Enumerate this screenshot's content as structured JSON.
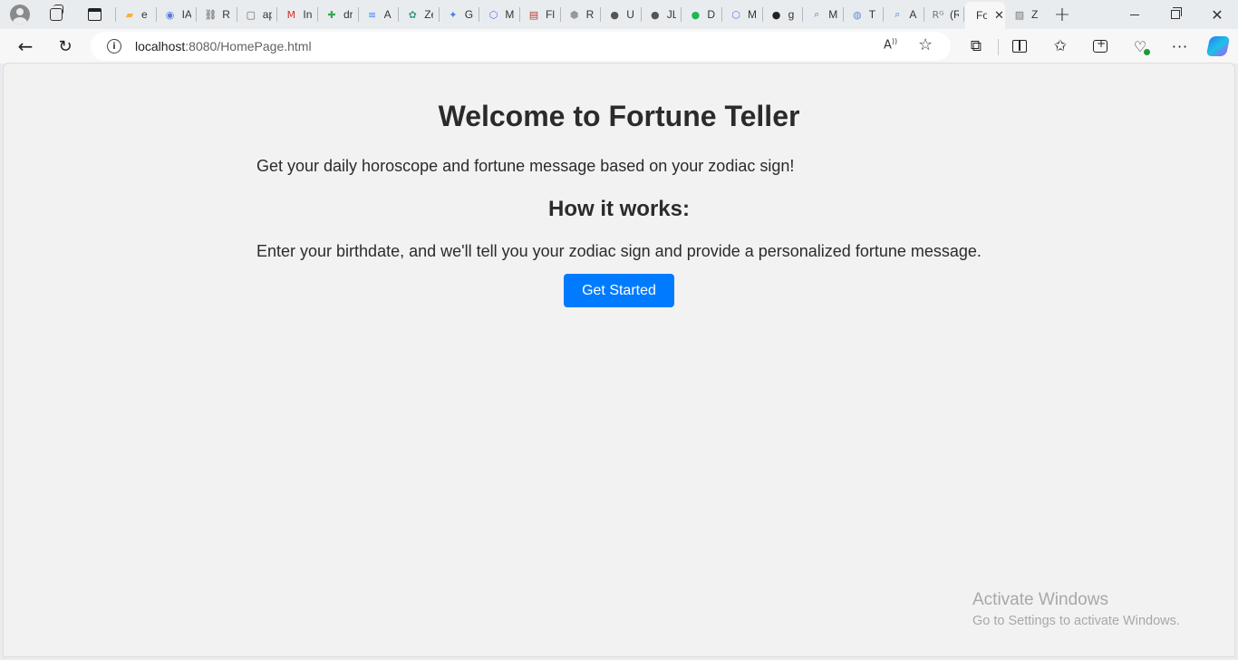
{
  "tabs": [
    {
      "icon": "folder-icon",
      "label": "e",
      "glyph": "▰",
      "color": "#f2b23e"
    },
    {
      "icon": "shield-icon",
      "label": "IA",
      "glyph": "◉",
      "color": "#5b7bd8"
    },
    {
      "icon": "link-icon",
      "label": "R",
      "glyph": "⛓",
      "color": "#444444"
    },
    {
      "icon": "page-icon",
      "label": "ap",
      "glyph": "▢",
      "color": "#666666"
    },
    {
      "icon": "gmail-icon",
      "label": "In",
      "glyph": "M",
      "color": "#d93025"
    },
    {
      "icon": "plus-sheet-icon",
      "label": "dr",
      "glyph": "✚",
      "color": "#34a853"
    },
    {
      "icon": "doc-lines-icon",
      "label": "A",
      "glyph": "≡",
      "color": "#4285f4"
    },
    {
      "icon": "openai-icon",
      "label": "Ze",
      "glyph": "✿",
      "color": "#3a9c8a"
    },
    {
      "icon": "sparkle-icon",
      "label": "G",
      "glyph": "✦",
      "color": "#4f7be8"
    },
    {
      "icon": "hexagon-icon",
      "label": "M",
      "glyph": "⬡",
      "color": "#5b6ee8"
    },
    {
      "icon": "pdf-icon",
      "label": "Fl",
      "glyph": "▤",
      "color": "#c0392b"
    },
    {
      "icon": "cube-icon",
      "label": "R",
      "glyph": "⬢",
      "color": "#999999"
    },
    {
      "icon": "github-dark-icon",
      "label": "U",
      "glyph": "●",
      "color": "#555555"
    },
    {
      "icon": "github-dark-icon",
      "label": "JL",
      "glyph": "●",
      "color": "#555555"
    },
    {
      "icon": "spotify-icon",
      "label": "D",
      "glyph": "●",
      "color": "#1db954"
    },
    {
      "icon": "hexagon-icon",
      "label": "M",
      "glyph": "⬡",
      "color": "#6a75e0"
    },
    {
      "icon": "github-icon",
      "label": "g",
      "glyph": "●",
      "color": "#222222"
    },
    {
      "icon": "search-icon",
      "label": "M",
      "glyph": "⌕",
      "color": "#4a79c9"
    },
    {
      "icon": "globe-icon",
      "label": "T",
      "glyph": "◍",
      "color": "#6a8ed0"
    },
    {
      "icon": "search-icon",
      "label": "A",
      "glyph": "⌕",
      "color": "#4a79c9"
    },
    {
      "icon": "researchgate-icon",
      "label": "(R",
      "glyph": "Rᴳ",
      "color": "#777777"
    }
  ],
  "active_tab": {
    "label": "Fo"
  },
  "last_tab": {
    "icon": "chart-icon",
    "label": "Z",
    "glyph": "▨",
    "color": "#777777"
  },
  "address": {
    "host": "localhost",
    "path": ":8080/HomePage.html"
  },
  "page": {
    "title": "Welcome to Fortune Teller",
    "intro": "Get your daily horoscope and fortune message based on your zodiac sign!",
    "how_title": "How it works:",
    "how_text": "Enter your birthdate, and we'll tell you your zodiac sign and provide a personalized fortune message.",
    "cta_label": "Get Started"
  },
  "watermark": {
    "title": "Activate Windows",
    "subtitle": "Go to Settings to activate Windows."
  },
  "colors": {
    "accent": "#007bff",
    "page_bg": "#f2f2f2",
    "chrome_bg": "#e9ecef"
  }
}
